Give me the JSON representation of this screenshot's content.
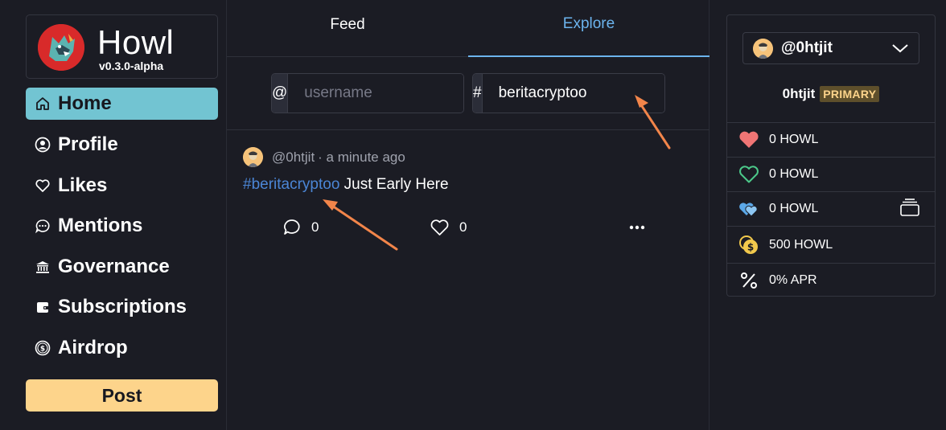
{
  "app": {
    "name": "Howl",
    "version": "v0.3.0-alpha"
  },
  "sidebar": {
    "items": [
      {
        "label": "Home",
        "icon": "home-icon",
        "active": true
      },
      {
        "label": "Profile",
        "icon": "profile-icon"
      },
      {
        "label": "Likes",
        "icon": "heart-icon"
      },
      {
        "label": "Mentions",
        "icon": "chat-icon"
      },
      {
        "label": "Governance",
        "icon": "bank-icon"
      },
      {
        "label": "Subscriptions",
        "icon": "wallet-icon"
      },
      {
        "label": "Airdrop",
        "icon": "coin-icon"
      }
    ],
    "post_label": "Post"
  },
  "tabs": {
    "feed": "Feed",
    "explore": "Explore",
    "active": "Explore"
  },
  "search": {
    "user_prefix": "@",
    "user_placeholder": "username",
    "user_value": "",
    "tag_prefix": "#",
    "tag_value": "beritacryptoo"
  },
  "post": {
    "author": "@0htjit",
    "time": "· a minute ago",
    "hashtag": "#beritacryptoo",
    "text": " Just Early Here",
    "comments": "0",
    "likes": "0"
  },
  "account": {
    "handle": "@0htjit",
    "name": "0htjit",
    "badge": "PRIMARY",
    "stats": [
      {
        "icon": "heart-filled-icon",
        "value": "0 HOWL",
        "color": "#f07575"
      },
      {
        "icon": "heart-outline-icon",
        "value": "0 HOWL",
        "color": "#4cc98a"
      },
      {
        "icon": "hearts-icon",
        "value": "0 HOWL",
        "color": "#5ba8e8"
      },
      {
        "icon": "coins-icon",
        "value": "500 HOWL",
        "color": "#f2c94c"
      },
      {
        "icon": "percent-icon",
        "value": "0% APR",
        "color": "#ffffff"
      }
    ]
  },
  "colors": {
    "background": "#1b1c24",
    "active_nav": "#72c4d2",
    "post_button": "#fdd48b",
    "accent_tab": "#6cb4ee",
    "hashtag": "#4b86d6",
    "arrow": "#f2854a"
  }
}
